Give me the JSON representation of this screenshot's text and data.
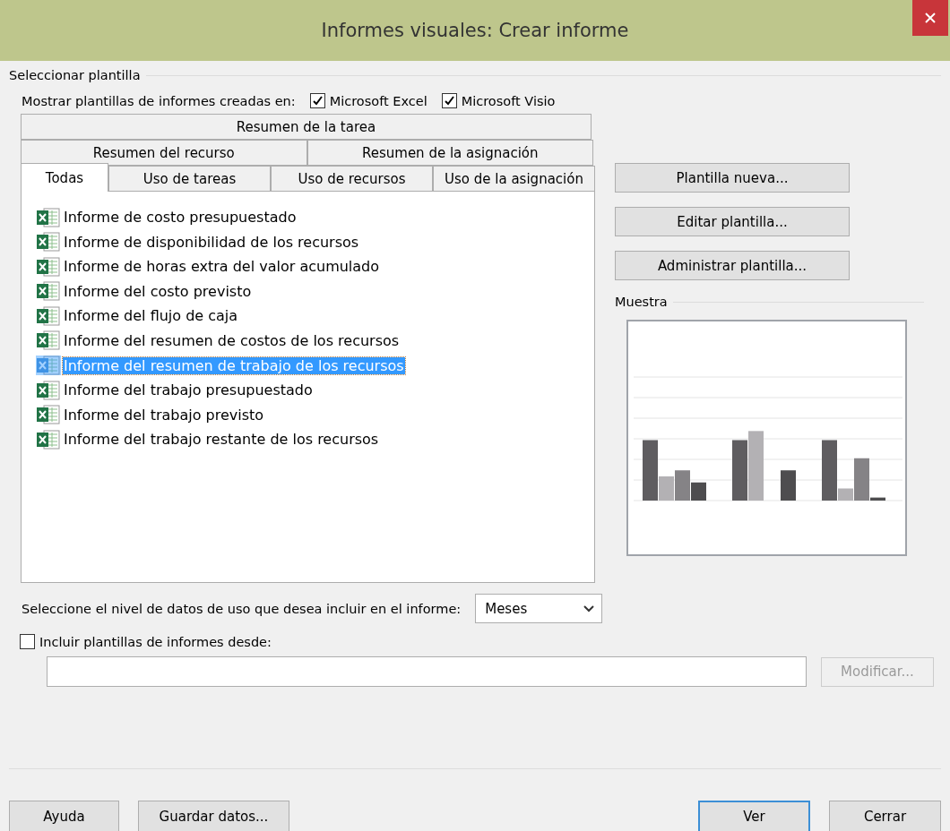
{
  "window": {
    "title": "Informes visuales: Crear informe"
  },
  "template_section": {
    "title": "Seleccionar plantilla",
    "show_label": "Mostrar plantillas de informes creadas en:",
    "sources": [
      {
        "label": "Microsoft Excel",
        "checked": true
      },
      {
        "label": "Microsoft Visio",
        "checked": true
      }
    ],
    "tab_rows": [
      [
        {
          "label": "Resumen de la tarea",
          "selected": false
        }
      ],
      [
        {
          "label": "Resumen del recurso",
          "selected": false
        },
        {
          "label": "Resumen de la asignación",
          "selected": false
        }
      ],
      [
        {
          "label": "Todas",
          "selected": true
        },
        {
          "label": "Uso de tareas",
          "selected": false
        },
        {
          "label": "Uso de recursos",
          "selected": false
        },
        {
          "label": "Uso de la asignación",
          "selected": false
        }
      ]
    ],
    "templates": [
      {
        "label": "Informe de costo presupuestado",
        "selected": false
      },
      {
        "label": "Informe de disponibilidad de los recursos",
        "selected": false
      },
      {
        "label": "Informe de horas extra del valor acumulado",
        "selected": false
      },
      {
        "label": "Informe del costo previsto",
        "selected": false
      },
      {
        "label": "Informe del flujo de caja",
        "selected": false
      },
      {
        "label": "Informe del resumen de costos de los recursos",
        "selected": false
      },
      {
        "label": "Informe del resumen de trabajo de los recursos",
        "selected": true
      },
      {
        "label": "Informe del trabajo presupuestado",
        "selected": false
      },
      {
        "label": "Informe del trabajo previsto",
        "selected": false
      },
      {
        "label": "Informe del trabajo restante de los recursos",
        "selected": false
      }
    ],
    "side_buttons": [
      "Plantilla nueva...",
      "Editar plantilla...",
      "Administrar plantilla..."
    ],
    "preview_title": "Muestra"
  },
  "usage_level": {
    "label": "Seleccione el nivel de datos de uso que desea incluir en el informe:",
    "value": "Meses"
  },
  "include": {
    "label": "Incluir plantillas de informes desde:",
    "checked": false,
    "button": {
      "label": "Modificar...",
      "disabled": true
    }
  },
  "footer_left": [
    "Ayuda",
    "Guardar datos..."
  ],
  "footer_right": [
    {
      "label": "Ver",
      "default": true
    },
    {
      "label": "Cerrar",
      "default": false
    }
  ]
}
